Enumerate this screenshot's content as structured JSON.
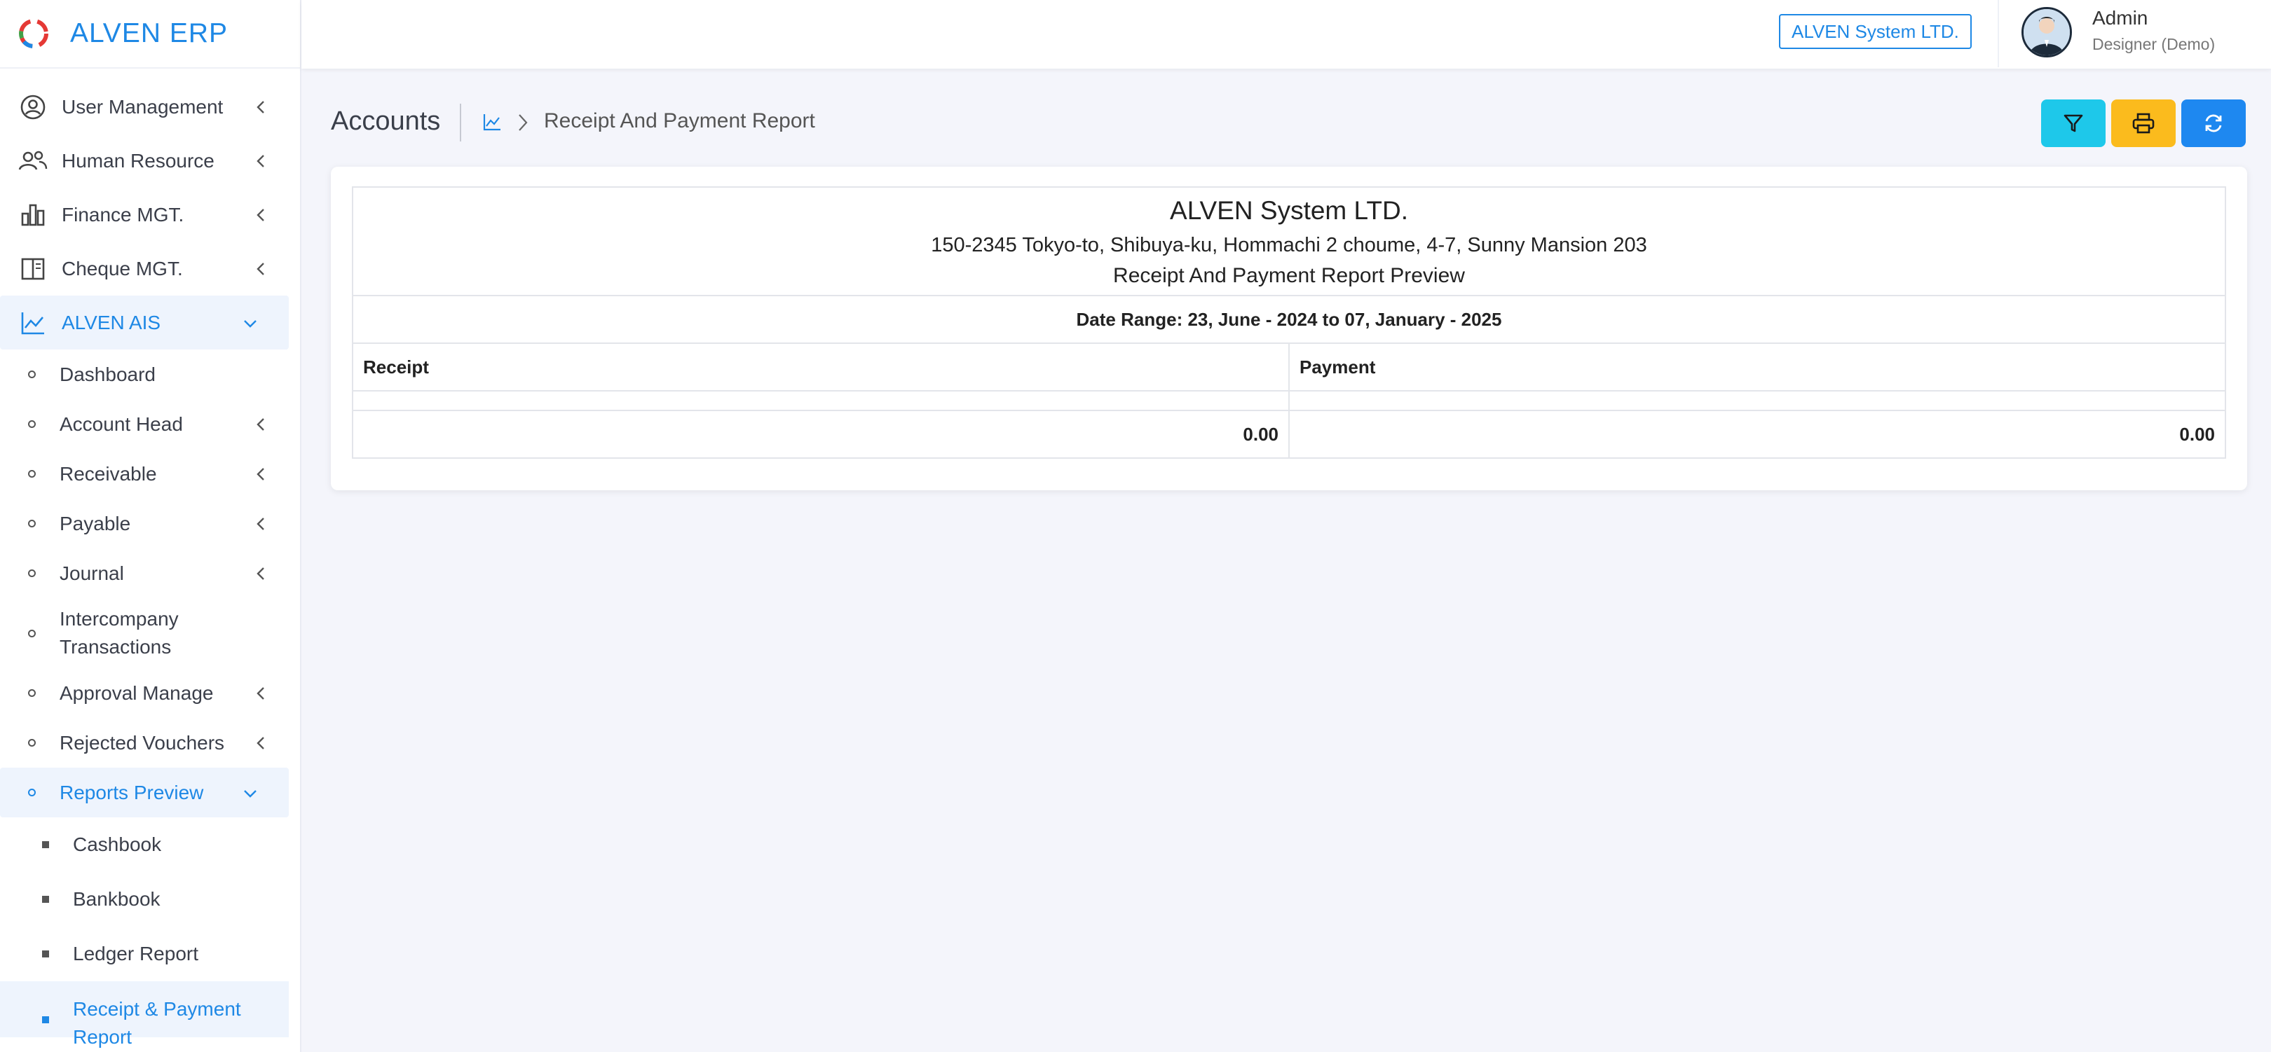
{
  "app": {
    "title": "ALVEN ERP"
  },
  "colors": {
    "accent": "#1e88e5",
    "filter_btn": "#1ec8ea",
    "print_btn": "#fbbb1d",
    "refresh_btn": "#1e88f0"
  },
  "sidebar": {
    "items": [
      {
        "label": "User Management",
        "icon": "user-circle-icon"
      },
      {
        "label": "Human Resource",
        "icon": "users-icon"
      },
      {
        "label": "Finance MGT.",
        "icon": "bar-chart-icon"
      },
      {
        "label": "Cheque MGT.",
        "icon": "book-icon"
      },
      {
        "label": "ALVEN AIS",
        "icon": "line-chart-icon",
        "expanded": true
      }
    ],
    "ais_sub": [
      {
        "label": "Dashboard"
      },
      {
        "label": "Account Head"
      },
      {
        "label": "Receivable"
      },
      {
        "label": "Payable"
      },
      {
        "label": "Journal"
      },
      {
        "label": "Intercompany Transactions"
      },
      {
        "label": "Approval Manage"
      },
      {
        "label": "Rejected Vouchers"
      },
      {
        "label": "Reports Preview",
        "expanded": true
      }
    ],
    "reports_sub": [
      {
        "label": "Cashbook"
      },
      {
        "label": "Bankbook"
      },
      {
        "label": "Ledger Report"
      },
      {
        "label": "Receipt & Payment Report",
        "active": true
      }
    ]
  },
  "header": {
    "company_badge": "ALVEN System LTD.",
    "user_name": "Admin",
    "user_role": "Designer (Demo)"
  },
  "page": {
    "title": "Accounts",
    "breadcrumb": "Receipt And Payment Report"
  },
  "report": {
    "company": "ALVEN System LTD.",
    "address": "150-2345 Tokyo-to, Shibuya-ku, Hommachi 2 choume, 4-7, Sunny Mansion 203",
    "subtitle": "Receipt And Payment Report Preview",
    "date_range": "Date Range: 23, June - 2024 to 07, January - 2025",
    "columns": [
      "Receipt",
      "Payment"
    ],
    "totals": {
      "receipt": "0.00",
      "payment": "0.00"
    }
  }
}
